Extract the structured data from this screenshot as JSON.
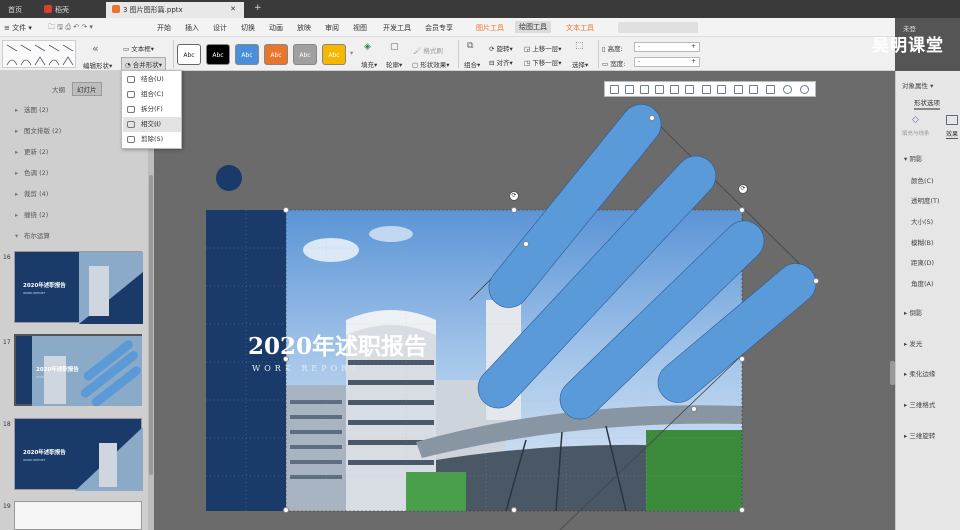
{
  "tabs": [
    {
      "label": "首页"
    },
    {
      "label": "稻壳"
    },
    {
      "label": "3 图片图形篇.pptx"
    }
  ],
  "watermark": "吴明课堂",
  "menus": [
    "文件",
    "开始",
    "插入",
    "设计",
    "切换",
    "动画",
    "放映",
    "审阅",
    "视图",
    "开发工具",
    "会员专享",
    "图片工具",
    "绘图工具",
    "文本工具"
  ],
  "sign_in": "未登",
  "ribbon": {
    "edit_shape": "编辑形状",
    "textbox": "文本框",
    "merge_shape": "合并形状",
    "swatch_text": "Abc",
    "fill": "填充",
    "outline": "轮廓",
    "shape_style": "形状效果",
    "fmt_painter": "格式刷",
    "group": "组合",
    "rotate": "旋转",
    "align": "对齐",
    "bring_forward": "上移一层",
    "send_backward": "下移一层",
    "select": "选择",
    "height_label": "高度:",
    "width_label": "宽度:",
    "height_value": "-",
    "width_value": "-"
  },
  "dropdown": {
    "items": [
      {
        "label": "结合(U)"
      },
      {
        "label": "组合(C)"
      },
      {
        "label": "拆分(F)"
      },
      {
        "label": "相交(I)"
      },
      {
        "label": "剪除(S)"
      }
    ],
    "hovered_index": 3
  },
  "left_panel": {
    "tabs": {
      "outline": "大纲",
      "slides": "幻灯片"
    },
    "sections": [
      {
        "label": "选图 (2)"
      },
      {
        "label": "图文排版 (2)"
      },
      {
        "label": "更新 (2)"
      },
      {
        "label": "色调 (2)"
      },
      {
        "label": "裁剪 (4)"
      },
      {
        "label": "缠绕 (2)"
      },
      {
        "label": "布尔运算"
      }
    ],
    "slides": [
      {
        "num": "16",
        "title": "2020年述职报告",
        "subtitle": "WORK REPORT"
      },
      {
        "num": "17",
        "title": "2020年述职报告",
        "subtitle": "WORK REPORT"
      },
      {
        "num": "18",
        "title": "2020年述职报告",
        "subtitle": "WORK REPORT"
      },
      {
        "num": "19",
        "title": "",
        "subtitle": ""
      }
    ]
  },
  "slide": {
    "title": "2020年述职报告",
    "subtitle": "WORK REPORT"
  },
  "right_panel": {
    "header": "对象属性",
    "tab_shape": "形状选项",
    "subtab_fill": "填充与线条",
    "subtab_effect": "效果",
    "sections": [
      {
        "label": "阴影",
        "expanded": true
      },
      {
        "label": "颜色(C)"
      },
      {
        "label": "透明度(T)"
      },
      {
        "label": "大小(S)"
      },
      {
        "label": "模糊(B)"
      },
      {
        "label": "距离(D)"
      },
      {
        "label": "角度(A)"
      },
      {
        "label": "倒影"
      },
      {
        "label": "发光"
      },
      {
        "label": "柔化边缘"
      },
      {
        "label": "三维格式"
      },
      {
        "label": "三维旋转"
      }
    ]
  },
  "colors": {
    "accent_orange": "#e8762c",
    "shape_blue": "#5a9ad8",
    "slide_navy": "#1a3a6a"
  }
}
